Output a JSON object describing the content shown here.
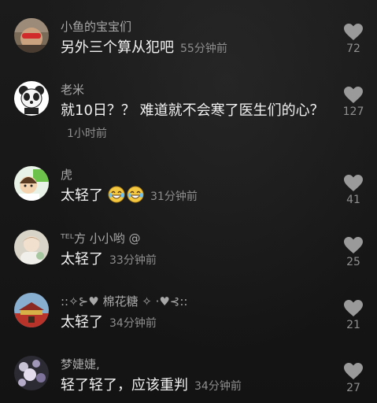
{
  "comments": [
    {
      "username": "小鱼的宝宝们",
      "text": "另外三个算从犯吧",
      "time": "55分钟前",
      "likes": "72",
      "avatar": "photo-avatar-red-band"
    },
    {
      "username": "老米",
      "text": "就10日？？ 难道就不会寒了医生们的心？",
      "time": "1小时前",
      "likes": "127",
      "avatar": "panda-avatar"
    },
    {
      "username": "虎",
      "text": "太轻了",
      "emoji": [
        "laughing-crying-emoji",
        "laughing-crying-emoji"
      ],
      "time": "31分钟前",
      "likes": "41",
      "avatar": "cartoon-avatar-green"
    },
    {
      "username": "ᵀᴱᴸ方 小小哟 @",
      "text": "太轻了",
      "time": "33分钟前",
      "likes": "25",
      "avatar": "photo-avatar-doll"
    },
    {
      "username": "::✧⊱♥ 棉花糖 ✧ ·♥⊰::",
      "text": "太轻了",
      "time": "34分钟前",
      "likes": "21",
      "avatar": "photo-avatar-tiananmen"
    },
    {
      "username": "梦婕婕,",
      "text": "轻了轻了，应该重判",
      "time": "34分钟前",
      "likes": "27",
      "avatar": "photo-avatar-flowers"
    }
  ],
  "colors": {
    "background": "#161616",
    "username": "#a8a8a8",
    "comment": "#f2f2f2",
    "meta": "#8e8e8e",
    "heart": "#9a9a9a"
  }
}
